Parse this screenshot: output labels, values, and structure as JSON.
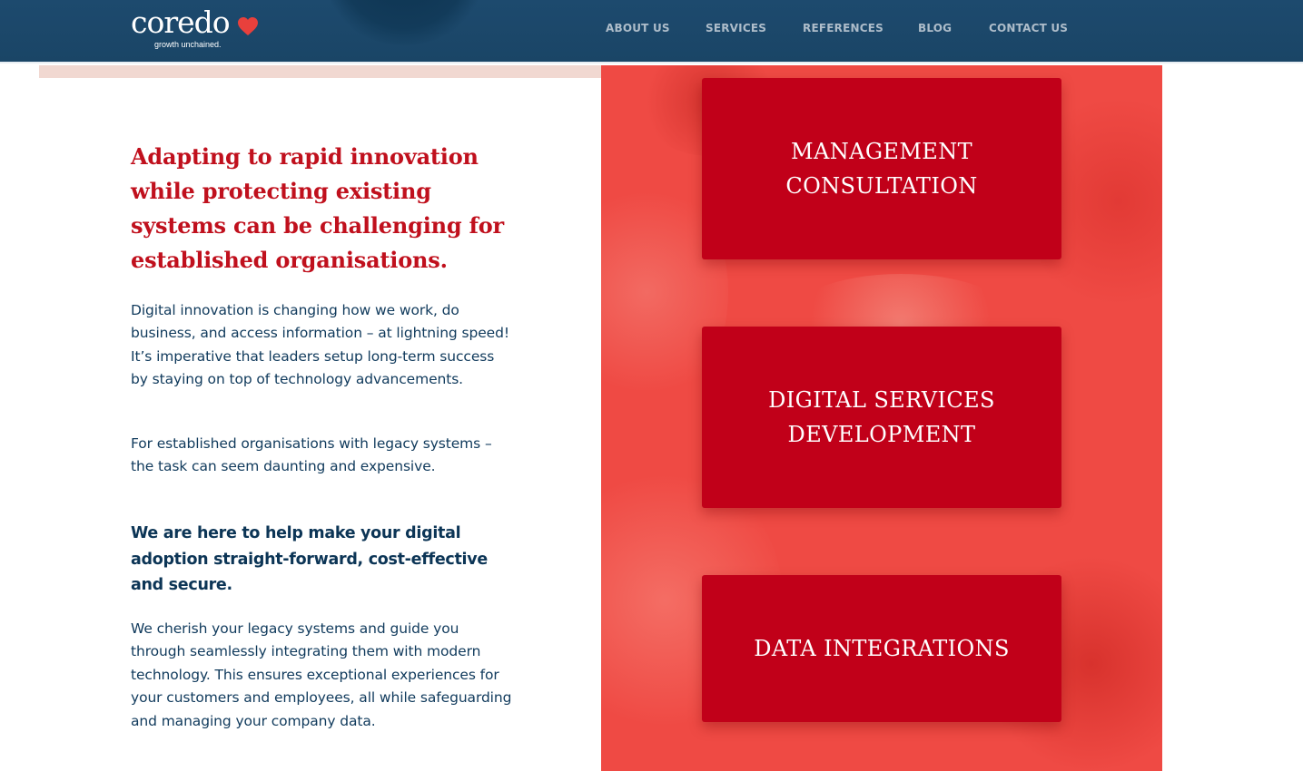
{
  "header": {
    "logo": {
      "wordmark": "coredo",
      "tagline": "growth unchained.",
      "icon": "heart-icon",
      "heart_color": "#e8403c"
    },
    "nav": [
      {
        "label": "ABOUT US"
      },
      {
        "label": "SERVICES"
      },
      {
        "label": "REFERENCES"
      },
      {
        "label": "BLOG"
      },
      {
        "label": "CONTACT US"
      }
    ],
    "background_color": "#1d4a6e"
  },
  "main": {
    "heading": "Adapting to rapid innovation while protecting existing systems can be challenging for established organisations.",
    "paragraphs": [
      "Digital innovation is changing how we work, do business, and access information – at lightning speed! It’s imperative that leaders setup long-term success by staying on top of technology advancements.",
      "For established organisations with legacy systems – the task can seem daunting and expensive."
    ],
    "emphasis": "We are here to help make your digital adoption straight-forward, cost-effective and secure.",
    "closing": "We cherish your legacy systems and guide you through seamlessly integrating them with modern technology. This ensures exceptional experiences for your customers and employees, all while safeguarding and managing your company data.",
    "heading_color": "#c0101d",
    "text_color": "#103a5c"
  },
  "services": {
    "panel_color": "#ef4a44",
    "card_color": "#c10019",
    "cards": [
      {
        "label": "MANAGEMENT CONSULTATION"
      },
      {
        "label": "DIGITAL SERVICES DEVELOPMENT"
      },
      {
        "label": "DATA INTEGRATIONS"
      }
    ]
  }
}
